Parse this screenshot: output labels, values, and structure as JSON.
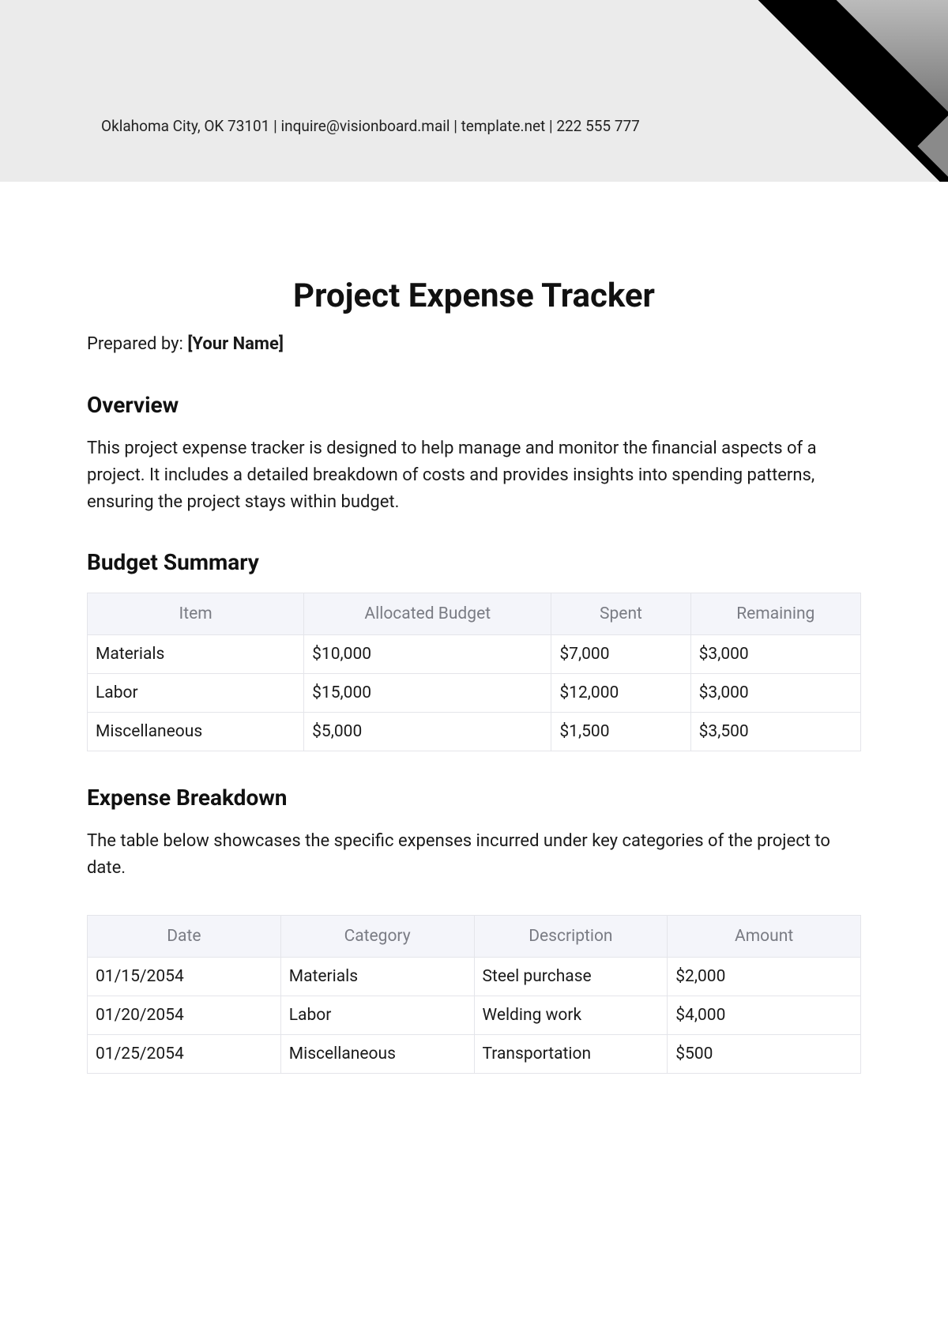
{
  "header": {
    "contact": "Oklahoma City, OK 73101 | inquire@visionboard.mail | template.net | 222 555 777"
  },
  "title": "Project Expense Tracker",
  "prepared": {
    "label": "Prepared by: ",
    "name": "[Your Name]"
  },
  "overview": {
    "heading": "Overview",
    "body": "This project expense tracker is designed to help manage and monitor the financial aspects of a project. It includes a detailed breakdown of costs and provides insights into spending patterns, ensuring the project stays within budget."
  },
  "budget": {
    "heading": "Budget Summary",
    "columns": [
      "Item",
      "Allocated Budget",
      "Spent",
      "Remaining"
    ],
    "rows": [
      {
        "item": "Materials",
        "allocated": "$10,000",
        "spent": "$7,000",
        "remaining": "$3,000"
      },
      {
        "item": "Labor",
        "allocated": "$15,000",
        "spent": "$12,000",
        "remaining": "$3,000"
      },
      {
        "item": "Miscellaneous",
        "allocated": "$5,000",
        "spent": "$1,500",
        "remaining": "$3,500"
      }
    ]
  },
  "expenses": {
    "heading": "Expense Breakdown",
    "body": "The table below showcases the specific expenses incurred under key categories of the project to date.",
    "columns": [
      "Date",
      "Category",
      "Description",
      "Amount"
    ],
    "rows": [
      {
        "date": "01/15/2054",
        "category": "Materials",
        "description": "Steel purchase",
        "amount": "$2,000"
      },
      {
        "date": "01/20/2054",
        "category": "Labor",
        "description": "Welding work",
        "amount": "$4,000"
      },
      {
        "date": "01/25/2054",
        "category": "Miscellaneous",
        "description": "Transportation",
        "amount": "$500"
      }
    ]
  }
}
